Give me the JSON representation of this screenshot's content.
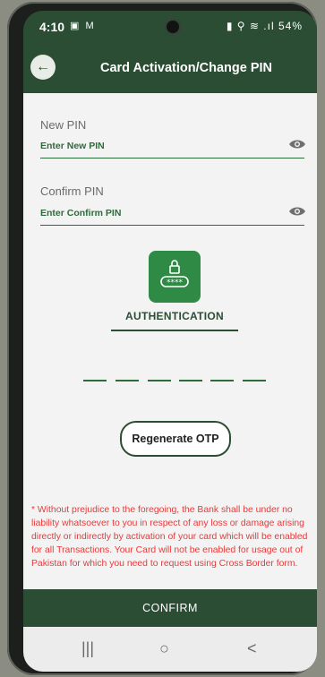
{
  "status_bar": {
    "time": "4:10",
    "notification_icons": "▣ M",
    "system_icons": "▮ ⚲ ≋ .ıl",
    "battery": "54%"
  },
  "app_bar": {
    "back_icon": "arrow-left-icon",
    "title": "Card Activation/Change PIN"
  },
  "form": {
    "new_pin": {
      "label": "New PIN",
      "placeholder": "Enter New PIN",
      "icon": "eye-icon"
    },
    "confirm_pin": {
      "label": "Confirm PIN",
      "placeholder": "Enter Confirm PIN",
      "icon": "eye-icon"
    }
  },
  "authentication": {
    "icon": "lock-pin-icon",
    "title": "AUTHENTICATION",
    "otp_slots": 6,
    "regenerate_label": "Regenerate OTP"
  },
  "disclaimer": "* Without prejudice to the foregoing, the Bank shall be under no liability whatsoever to you in respect of any loss or damage arising directly or indirectly by activation of your card which will be enabled for all Transactions. Your Card will not be enabled for usage out of Pakistan for which you need to request using Cross Border form.",
  "confirm_label": "CONFIRM",
  "nav_bar": {
    "recents": "|||",
    "home": "○",
    "back": "<"
  },
  "colors": {
    "primary": "#2b4d34",
    "accent_green": "#2f8a46",
    "warning_text": "#e83a3a",
    "background": "#f3f3f3"
  }
}
